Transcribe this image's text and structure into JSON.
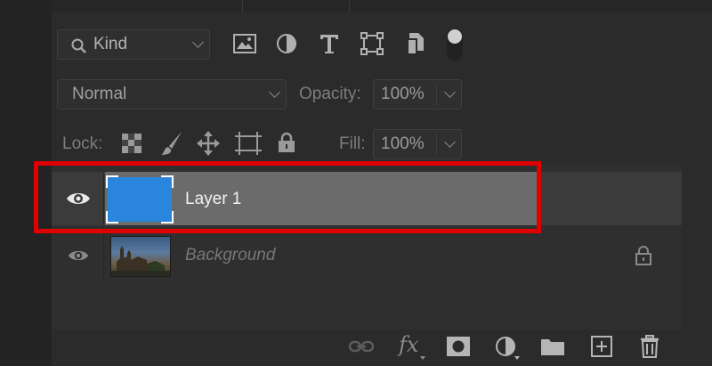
{
  "filter": {
    "kind_label": "Kind",
    "icons": [
      "image-filter-icon",
      "adjustment-filter-icon",
      "type-filter-icon",
      "shape-filter-icon",
      "smart-object-filter-icon",
      "filter-toggle-icon"
    ]
  },
  "blend": {
    "mode": "Normal",
    "opacity_label": "Opacity:",
    "opacity_value": "100%"
  },
  "lock": {
    "label": "Lock:",
    "icons": [
      "lock-transparency-icon",
      "lock-image-pixels-icon",
      "lock-position-icon",
      "lock-artboard-icon",
      "lock-all-icon"
    ],
    "fill_label": "Fill:",
    "fill_value": "100%"
  },
  "layers": [
    {
      "name": "Layer 1",
      "thumbnail_color": "#2a86dd",
      "selected": true,
      "highlighted": true
    },
    {
      "name": "Background",
      "locked": true
    }
  ],
  "colors": {
    "highlight": "#e00000",
    "layer_fill": "#2a86dd",
    "selected_row": "#6b6b6b"
  },
  "bottom_icons": [
    "link-layers-icon",
    "fx-icon",
    "mask-icon",
    "adjustment-layer-icon",
    "group-folder-icon",
    "new-layer-icon",
    "trash-icon"
  ]
}
